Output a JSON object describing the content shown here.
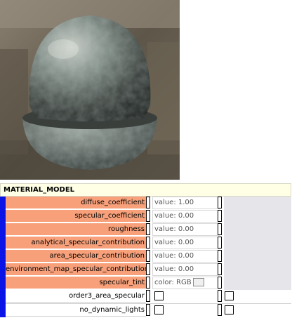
{
  "panel": {
    "title": "MATERIAL_MODEL"
  },
  "rows": [
    {
      "label": "diffuse_coefficient",
      "value": "value: 1.00"
    },
    {
      "label": "specular_coefficient",
      "value": "value: 0.00"
    },
    {
      "label": "roughness",
      "value": "value: 0.00"
    },
    {
      "label": "analytical_specular_contribution",
      "value": "value: 0.00"
    },
    {
      "label": "area_specular_contribution",
      "value": "value: 0.00"
    },
    {
      "label": "environment_map_specular_contribution",
      "value": "value: 0.00"
    },
    {
      "label": "specular_tint",
      "value": "color: RGB"
    }
  ],
  "flags": [
    {
      "label": "order3_area_specular",
      "checked": false
    },
    {
      "label": "no_dynamic_lights",
      "checked": false
    }
  ],
  "colors": {
    "accent_bar": "#0a14e6",
    "parameter_label_bg": "#f7a07a",
    "header_bg": "#ffffe6"
  }
}
